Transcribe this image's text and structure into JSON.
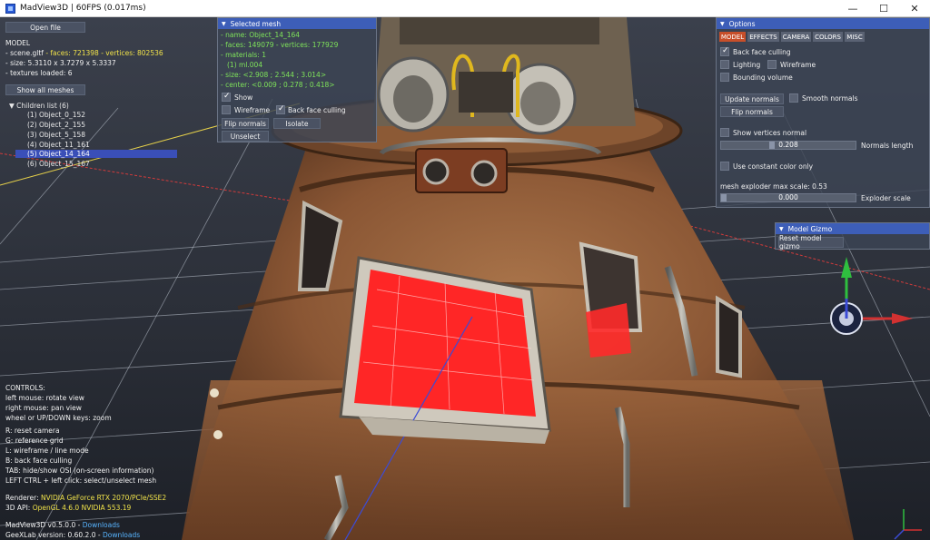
{
  "window": {
    "title": "MadView3D | 60FPS (0.017ms)",
    "btn_min": "—",
    "btn_max": "☐",
    "btn_close": "✕"
  },
  "left": {
    "open_file": "Open file",
    "model_label": "MODEL",
    "file_name": "- scene.gltf",
    "faces_vertices": "- faces: 721398 - vertices: 802536",
    "size": "- size: 5.3110 x 3.7279 x 5.3337",
    "textures": "- textures loaded: 6",
    "show_all_meshes": "Show all meshes",
    "children_header": "Children list (6)",
    "children": [
      "(1) Object_0_152",
      "(2) Object_2_155",
      "(3) Object_5_158",
      "(4) Object_11_161",
      "(5) Object_14_164",
      "(6) Object_15_167"
    ],
    "controls_title": "CONTROLS:",
    "controls": [
      "left mouse: rotate view",
      "right mouse: pan view",
      "wheel or UP/DOWN keys: zoom",
      "R: reset camera",
      "G: reference grid",
      "L: wireframe / line mode",
      "B: back face culling",
      "TAB: hide/show OSI (on-screen information)",
      "LEFT CTRL + left click: select/unselect mesh"
    ],
    "renderer_label": "Renderer:",
    "renderer_value": "NVIDIA GeForce RTX 2070/PCIe/SSE2",
    "api_label": "3D API:",
    "api_value": "OpenGL 4.6.0 NVIDIA 553.19",
    "version_label": "MadView3D v0.5.0.0 - ",
    "version_link": "Downloads",
    "geexlab_label": "GeeXLab version: 0.60.2.0 - ",
    "geexlab_link": "Downloads"
  },
  "selected_mesh": {
    "title": "Selected mesh",
    "name": "- name: Object_14_164",
    "faces": "- faces: 149079 - vertices: 177929",
    "materials": "- materials: 1",
    "material_1": "(1) ml.004",
    "size": "- size: <2.908 ; 2.544 ; 3.014>",
    "center": "- center: <0.009 ; 0.278 ; 0.418>",
    "show": "Show",
    "wireframe": "Wireframe",
    "back_face_culling": "Back face culling",
    "flip_normals": "Flip normals",
    "isolate": "Isolate",
    "unselect": "Unselect"
  },
  "options": {
    "title": "Options",
    "tabs": [
      "MODEL",
      "EFFECTS",
      "CAMERA",
      "COLORS",
      "MISC"
    ],
    "back_face_culling": "Back face culling",
    "lighting": "Lighting",
    "wireframe": "Wireframe",
    "bounding_volume": "Bounding volume",
    "update_normals": "Update normals",
    "smooth_normals": "Smooth normals",
    "flip_normals": "Flip normals",
    "show_vertices_normal": "Show vertices normal",
    "normals_length_value": "0.208",
    "normals_length_label": "Normals length",
    "normals_length_fraction": 0.38,
    "constant_color": "Use constant color only",
    "exploder_max_scale": "mesh exploder max scale: 0.53",
    "exploder_value": "0.000",
    "exploder_label": "Exploder scale",
    "exploder_fraction": 0.0
  },
  "gizmo": {
    "title": "Model Gizmo",
    "reset": "Reset model gizmo"
  },
  "colors": {
    "panel_head": "#3d5eb8",
    "tab_active": "#c74f2a",
    "highlight_red": "#ff2020",
    "text_green": "#7fe35a",
    "text_yellow": "#f0e24a",
    "link_blue": "#58b4ff"
  }
}
